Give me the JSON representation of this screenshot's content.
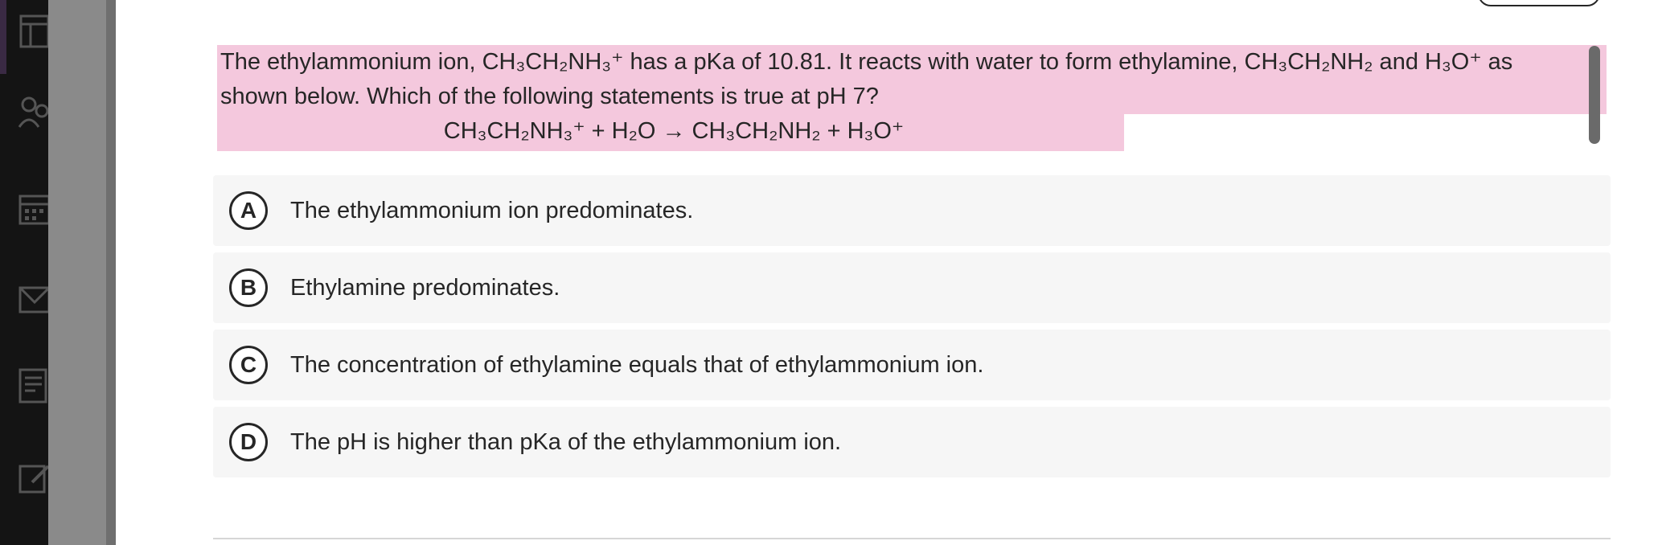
{
  "sidebar": {
    "icons": [
      "course-icon",
      "people-icon",
      "calendar-icon",
      "messages-icon",
      "grades-icon",
      "edit-icon"
    ]
  },
  "question": {
    "line1": "The ethylammonium ion, CH₃CH₂NH₃⁺ has a pKa of 10.81.  It reacts with water to form ethylamine, CH₃CH₂NH₂ and H₃O⁺ as",
    "line2": "shown below. Which of the following statements is true at pH 7?",
    "equation": "CH₃CH₂NH₃⁺ + H₂O → CH₃CH₂NH₂ + H₃O⁺"
  },
  "options": [
    {
      "letter": "A",
      "text": "The ethylammonium ion predominates."
    },
    {
      "letter": "B",
      "text": "Ethylamine predominates."
    },
    {
      "letter": "C",
      "text": "The concentration of ethylamine equals that of ethylammonium ion."
    },
    {
      "letter": "D",
      "text": "The pH is higher than pKa of the ethylammonium ion."
    }
  ],
  "colors": {
    "highlight": "#f4c8dd",
    "rail": "#141414",
    "option_bg": "#f6f6f6"
  }
}
